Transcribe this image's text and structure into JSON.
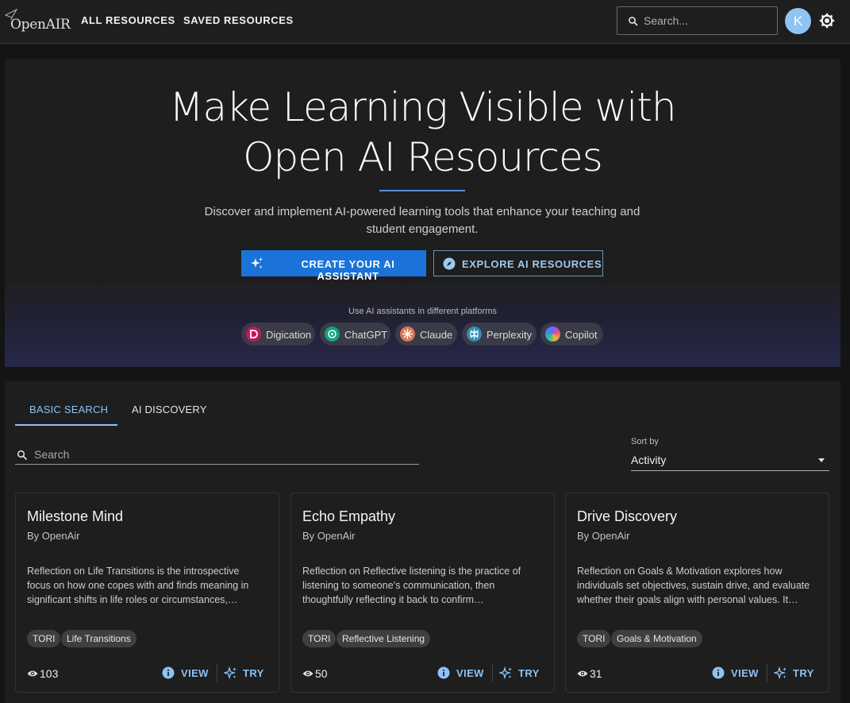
{
  "header": {
    "logo_text": "OpenAIR",
    "nav": [
      "ALL RESOURCES",
      "SAVED RESOURCES"
    ],
    "search_placeholder": "Search...",
    "avatar_initial": "K"
  },
  "hero": {
    "title_line1": "Make Learning Visible with",
    "title_line2": "Open AI Resources",
    "subtitle": "Discover and implement AI-powered learning tools that enhance your teaching and student engagement.",
    "primary_button": "CREATE YOUR AI ASSISTANT",
    "secondary_button": "EXPLORE AI RESOURCES",
    "platforms_label": "Use AI assistants in different platforms",
    "platforms": [
      {
        "name": "Digication",
        "color": "#c2185b"
      },
      {
        "name": "ChatGPT",
        "color": "#10a37f"
      },
      {
        "name": "Claude",
        "color": "#d97757"
      },
      {
        "name": "Perplexity",
        "color": "#2d8fb8"
      },
      {
        "name": "Copilot",
        "color": "#7b61ff"
      }
    ]
  },
  "filters": {
    "tabs": [
      "BASIC SEARCH",
      "AI DISCOVERY"
    ],
    "search_placeholder": "Search",
    "sort_label": "Sort by",
    "sort_value": "Activity"
  },
  "cards": [
    {
      "title": "Milestone Mind",
      "author": "By OpenAir",
      "description": "Reflection on Life Transitions is the introspective focus on how one copes with and finds meaning in significant shifts in life roles or circumstances,…",
      "tags": [
        "TORI",
        "Life Transitions"
      ],
      "views": "103",
      "view_label": "VIEW",
      "try_label": "TRY"
    },
    {
      "title": "Echo Empathy",
      "author": "By OpenAir",
      "description": "Reflection on Reflective listening is the practice of listening to someone’s communication, then thoughtfully reflecting it back to confirm…",
      "tags": [
        "TORI",
        "Reflective Listening"
      ],
      "views": "50",
      "view_label": "VIEW",
      "try_label": "TRY"
    },
    {
      "title": "Drive Discovery",
      "author": "By OpenAir",
      "description": "Reflection on Goals & Motivation explores how individuals set objectives, sustain drive, and evaluate whether their goals align with personal values. It…",
      "tags": [
        "TORI",
        "Goals & Motivation"
      ],
      "views": "31",
      "view_label": "VIEW",
      "try_label": "TRY"
    }
  ]
}
